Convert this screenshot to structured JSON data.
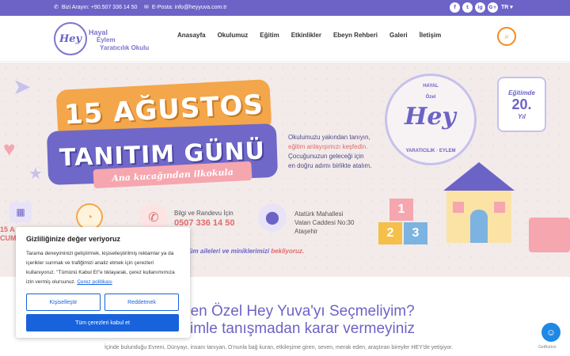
{
  "topbar": {
    "phone_text": "Bizi Arayın: +90.507 336 14 50",
    "email_text": "E-Posta: info@heyyuva.com.tr",
    "social": [
      "f",
      "t",
      "ig",
      "G+"
    ],
    "language": "TR ▾"
  },
  "logo": {
    "mark": "Hey",
    "line1": "Hayal",
    "line2": "Eylem",
    "line3": "Yaratıcılık Okulu"
  },
  "nav": {
    "items": [
      "Anasayfa",
      "Okulumuz",
      "Eğitim",
      "Etkinlikler",
      "Ebeyn Rehberi",
      "Galeri",
      "İletişim"
    ]
  },
  "hero": {
    "title_line1": "15 AĞUSTOS",
    "title_line2": "TANITIM GÜNÜ",
    "ribbon": "Ana kucağından ilkokula",
    "description": {
      "l1": "Okulumuzu yakından tanıyın,",
      "l2": "eğitim anlayışımızı keşfedin.",
      "l3": "Çocuğunuzun geleceği için",
      "l4": "en doğru adımı birlikte atalım."
    },
    "badge": {
      "top": "HAYAL",
      "sub": "Özel",
      "mark": "Hey",
      "bottom": "YARATICILIK · EYLEM"
    },
    "anniv": {
      "a": "Eğitimde",
      "b": "20.",
      "c": "Yıl"
    },
    "date_text": {
      "l1": "15 A",
      "l2": "CUMA"
    },
    "contact": {
      "label": "Bilgi ve Randevu İçin",
      "number": "0507 336 14 50"
    },
    "address": {
      "l1": "Atatürk Mahallesi",
      "l2": "Vatan Caddesi No:30",
      "l3": "Ataşehir"
    },
    "tagline_part1": "tüm aileleri ve miniklerimizi",
    "tagline_part2": "bekliyoruz.",
    "blocks": [
      "1",
      "2",
      "3"
    ]
  },
  "section": {
    "heading1": "den Özel Hey Yuva'yı Seçmeliyim?",
    "heading2": "imle tanışmadan karar vermeyiniz",
    "paragraph": "İçinde bulunduğu Evreni, Dünyayı, insanı tanıyan, O'nunla bağ kuran, etkileşime giren, seven, merak eden, araştıran bireyler HEY'de yetişiyor."
  },
  "cookie": {
    "title": "Gizliliğinize değer veriyoruz",
    "text": "Tarama deneyiminizi geliştirmek, kişiselleştirilmiş reklamlar ya da içerikler sunmak ve trafiğimizi analiz etmek için çerezleri kullanıyoruz. \"Tümünü Kabul Et\"e tıklayarak, çerez kullanımımıza izin vermiş olursunuz.",
    "link": "Çerez politikası",
    "customize": "Kişiselleştir",
    "reject": "Reddetmek",
    "accept_all": "Tüm çerezleri kabul et"
  },
  "getbutton": {
    "label": "GetButton"
  },
  "colors": {
    "brand": "#6c63c7",
    "accent": "#f08a24",
    "cookie_blue": "#1863dc"
  }
}
